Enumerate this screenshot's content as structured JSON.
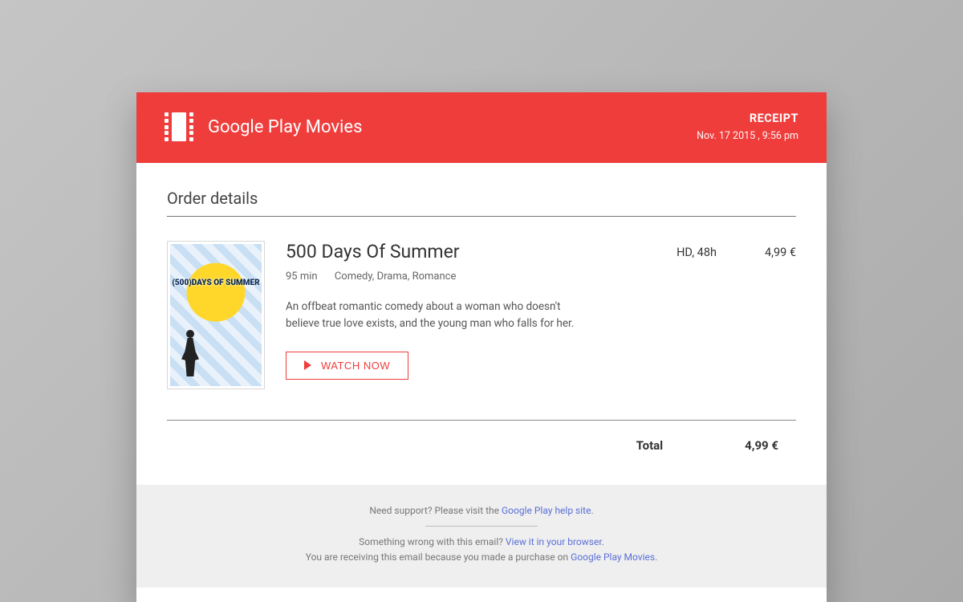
{
  "brand": {
    "name": "Google Play Movies"
  },
  "receipt": {
    "label": "RECEIPT",
    "timestamp": "Nov. 17 2015 , 9:56 pm"
  },
  "order": {
    "section_title": "Order details",
    "item": {
      "title": "500 Days Of Summer",
      "poster_text": "(500)DAYS OF SUMMER",
      "duration": "95 min",
      "genres": "Comedy, Drama, Romance",
      "description": "An offbeat romantic comedy about a woman who doesn't believe true love exists, and the young man who falls for her.",
      "watch_label": "WATCH NOW",
      "quality": "HD, 48h",
      "price": "4,99 €"
    },
    "total_label": "Total",
    "total_value": "4,99 €"
  },
  "footer": {
    "support_prefix": "Need support? Please visit the ",
    "support_link": "Google Play help site",
    "support_suffix": ".",
    "wrong_prefix": "Something wrong with this email? ",
    "wrong_link": "View it in your browser",
    "wrong_suffix": ".",
    "why_prefix": "You are receiving this email because you made a purchase on ",
    "why_link": "Google Play Movies",
    "why_suffix": "."
  }
}
